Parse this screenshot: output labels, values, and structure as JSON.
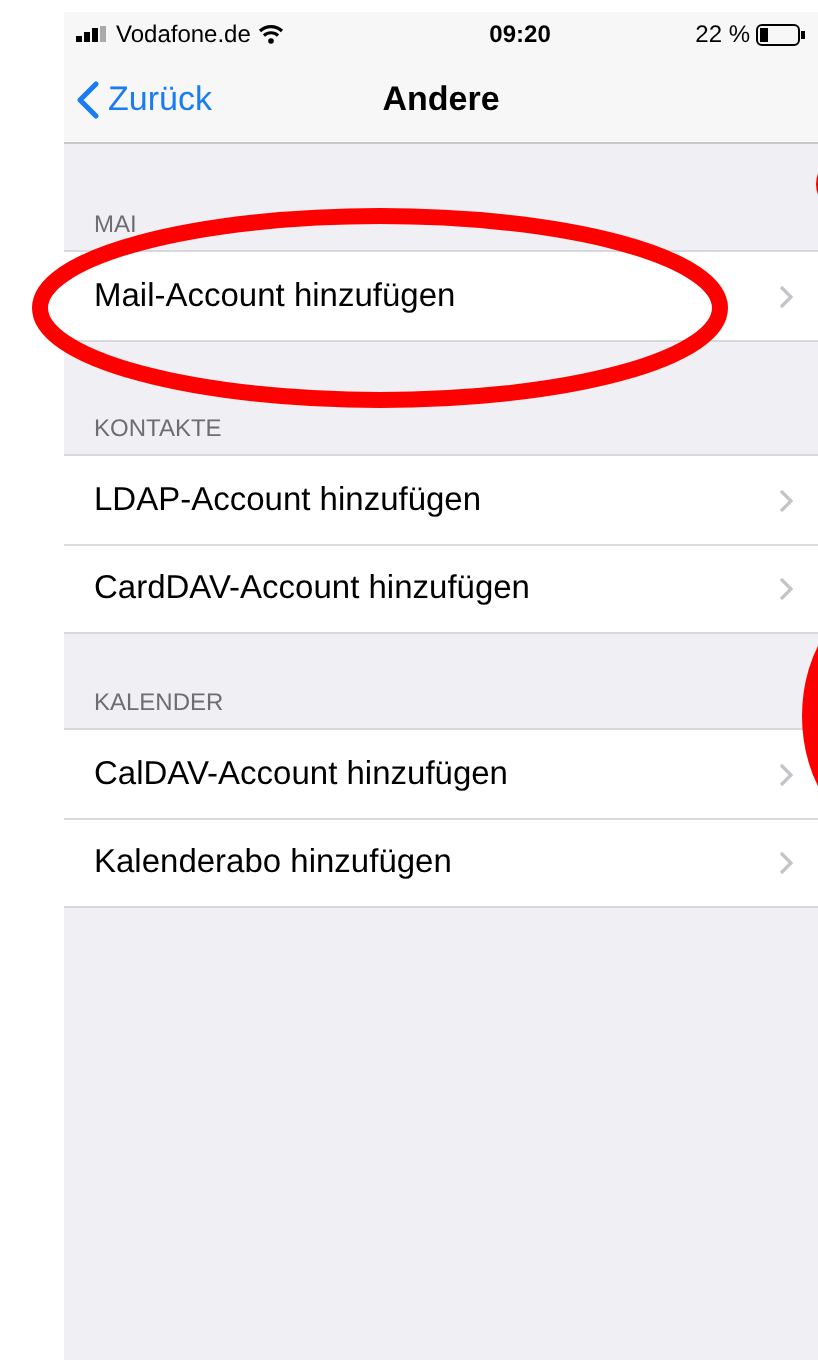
{
  "status_bar": {
    "carrier": "Vodafone.de",
    "time": "09:20",
    "battery": "22 %"
  },
  "nav": {
    "back": "Zurück",
    "title": "Andere"
  },
  "sections": [
    {
      "header": "MAI",
      "rows": [
        {
          "label": "Mail-Account hinzufügen"
        }
      ]
    },
    {
      "header": "KONTAKTE",
      "rows": [
        {
          "label": "LDAP-Account hinzufügen"
        },
        {
          "label": "CardDAV-Account hinzufügen"
        }
      ]
    },
    {
      "header": "KALENDER",
      "rows": [
        {
          "label": "CalDAV-Account hinzufügen"
        },
        {
          "label": "Kalenderabo hinzufügen"
        }
      ]
    }
  ]
}
